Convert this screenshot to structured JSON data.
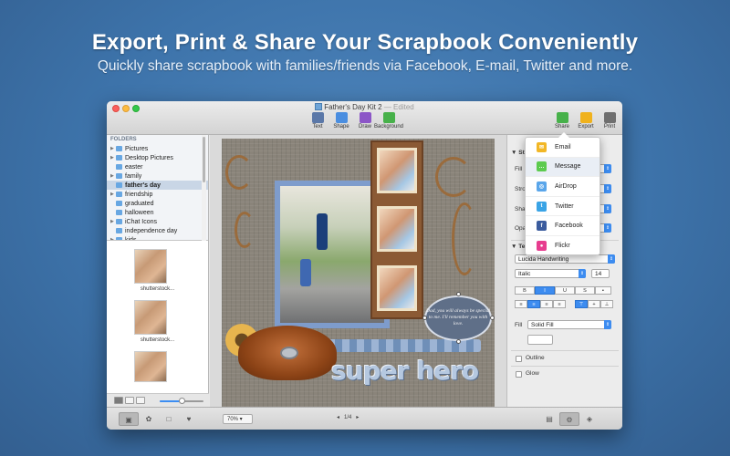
{
  "banner": {
    "headline": "Export, Print & Share Your Scrapbook Conveniently",
    "subline": "Quickly share scrapbook with families/friends via Facebook, E-mail, Twitter and more."
  },
  "window": {
    "title": "Father's Day Kit 2",
    "separator": "—",
    "edited": "Edited"
  },
  "toolbar": {
    "left_tools": [
      {
        "label": "Text",
        "icon": "text-icon",
        "color": "#5b78a8"
      },
      {
        "label": "Shape",
        "icon": "shape-icon",
        "color": "#4a8ee0"
      },
      {
        "label": "Draw",
        "icon": "pencil-icon",
        "color": "#8c56c7"
      },
      {
        "label": "Background",
        "icon": "background-icon",
        "color": "#47b14a"
      }
    ],
    "right_tools": [
      {
        "label": "Share",
        "icon": "share-icon",
        "color": "#47b14a"
      },
      {
        "label": "Export",
        "icon": "export-icon",
        "color": "#f0b21d"
      },
      {
        "label": "Print",
        "icon": "print-icon",
        "color": "#6f6f6f"
      }
    ]
  },
  "sidebar": {
    "folders_title": "FOLDERS",
    "folders": [
      {
        "label": "Pictures",
        "arrow": "▶",
        "selected": false
      },
      {
        "label": "Desktop Pictures",
        "arrow": "▶",
        "selected": false
      },
      {
        "label": "easter",
        "arrow": "",
        "selected": false
      },
      {
        "label": "family",
        "arrow": "▶",
        "selected": false
      },
      {
        "label": "father's day",
        "arrow": "",
        "selected": true
      },
      {
        "label": "friendship",
        "arrow": "▶",
        "selected": false
      },
      {
        "label": "graduated",
        "arrow": "",
        "selected": false
      },
      {
        "label": "halloween",
        "arrow": "",
        "selected": false
      },
      {
        "label": "iChat Icons",
        "arrow": "▶",
        "selected": false
      },
      {
        "label": "independence day",
        "arrow": "",
        "selected": false
      },
      {
        "label": "kids",
        "arrow": "▶",
        "selected": false
      }
    ],
    "thumbnails": [
      "shutterstock...",
      "shutterstock..."
    ]
  },
  "canvas": {
    "note_text": "Dad, you will always be special to me. I'll remember you with love.",
    "title_text": "super hero"
  },
  "inspector": {
    "style_header": "St",
    "labels": {
      "fill": "Fill",
      "stroke": "Stro",
      "shadow": "Sha",
      "opacity": "Opa"
    },
    "text_header": "Te",
    "font": "Lucida Handwriting",
    "font_style": "Italic",
    "font_size": "14",
    "style_buttons": [
      "B",
      "I",
      "U",
      "S"
    ],
    "text_fill_label": "Fill",
    "text_fill_value": "Solid Fill",
    "outline_label": "Outline",
    "glow_label": "Glow"
  },
  "share_menu": {
    "items": [
      {
        "label": "Email",
        "icon": "email-icon",
        "color": "#f2b726",
        "glyph": "✉"
      },
      {
        "label": "Message",
        "icon": "message-icon",
        "color": "#5ccb4e",
        "glyph": "…"
      },
      {
        "label": "AirDrop",
        "icon": "airdrop-icon",
        "color": "#5aa6ea",
        "glyph": "◎"
      },
      {
        "label": "Twitter",
        "icon": "twitter-icon",
        "color": "#3aa4e6",
        "glyph": "t"
      },
      {
        "label": "Facebook",
        "icon": "facebook-icon",
        "color": "#3b5c9e",
        "glyph": "f"
      },
      {
        "label": "Flickr",
        "icon": "flickr-icon",
        "color": "#e73d8f",
        "glyph": "●"
      }
    ]
  },
  "statusbar": {
    "zoom": "70%",
    "page": "1/4"
  }
}
